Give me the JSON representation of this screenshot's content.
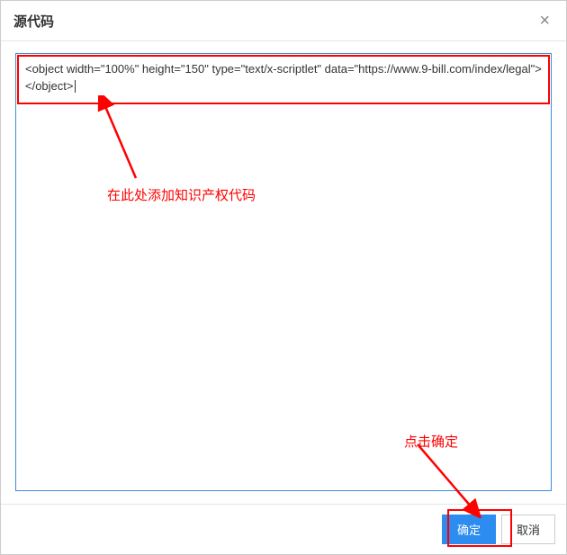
{
  "dialog": {
    "title": "源代码",
    "close_symbol": "×"
  },
  "editor": {
    "code": "<object width=\"100%\" height=\"150\" type=\"text/x-scriptlet\" data=\"https://www.9-bill.com/index/legal\"></object>"
  },
  "footer": {
    "confirm_label": "确定",
    "cancel_label": "取消"
  },
  "annotations": {
    "add_code_hint": "在此处添加知识产权代码",
    "click_confirm_hint": "点击确定"
  }
}
